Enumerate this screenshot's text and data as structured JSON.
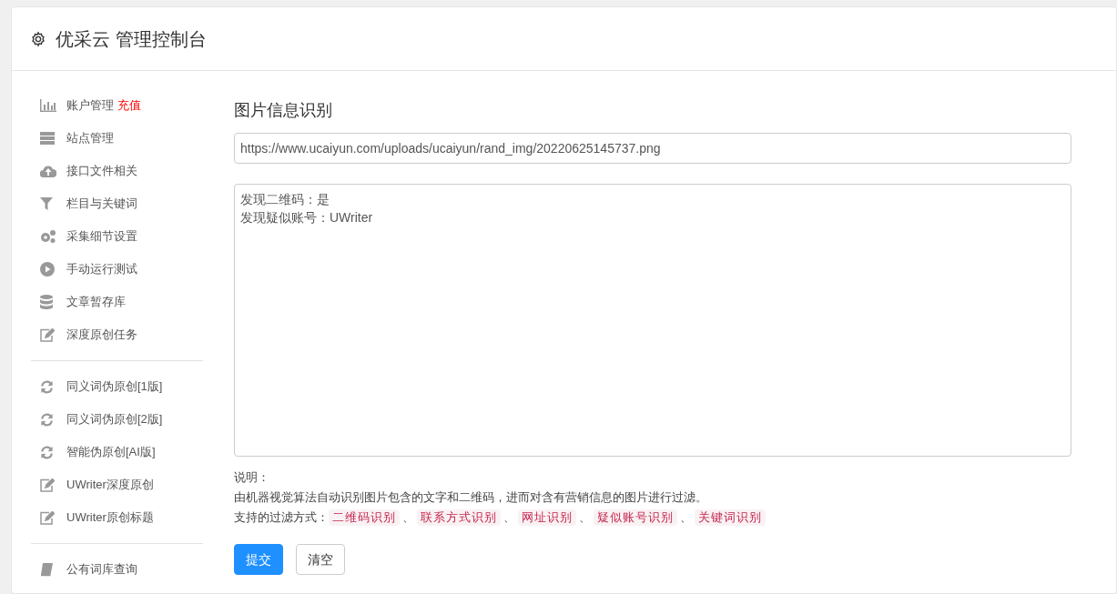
{
  "header": {
    "title": "优采云 管理控制台"
  },
  "sidebar": {
    "groups": [
      {
        "items": [
          {
            "label": "账户管理",
            "badge": "充值"
          },
          {
            "label": "站点管理"
          },
          {
            "label": "接口文件相关"
          },
          {
            "label": "栏目与关键词"
          },
          {
            "label": "采集细节设置"
          },
          {
            "label": "手动运行测试"
          },
          {
            "label": "文章暂存库"
          },
          {
            "label": "深度原创任务"
          }
        ]
      },
      {
        "items": [
          {
            "label": "同义词伪原创[1版]"
          },
          {
            "label": "同义词伪原创[2版]"
          },
          {
            "label": "智能伪原创[AI版]"
          },
          {
            "label": "UWriter深度原创"
          },
          {
            "label": "UWriter原创标题"
          }
        ]
      },
      {
        "items": [
          {
            "label": "公有词库查询"
          }
        ]
      }
    ]
  },
  "main": {
    "title": "图片信息识别",
    "url_field": {
      "value": "https://www.ucaiyun.com/uploads/ucaiyun/rand_img/20220625145737.png"
    },
    "result_box": {
      "lines": [
        "发现二维码：是",
        "发现疑似账号：UWriter"
      ]
    },
    "notes": {
      "heading": "说明：",
      "description": "由机器视觉算法自动识别图片包含的文字和二维码，进而对含有营销信息的图片进行过滤。",
      "methods_label": "支持的过滤方式：",
      "methods": [
        {
          "text": "二维码识别",
          "separator": "、"
        },
        {
          "text": "联系方式识别",
          "separator": "、"
        },
        {
          "text": "网址识别",
          "separator": "、"
        },
        {
          "text": "疑似账号识别",
          "separator": "、"
        },
        {
          "text": "关键词识别"
        }
      ]
    },
    "buttons": [
      {
        "label": "提交",
        "kind": "primary"
      },
      {
        "label": "清空",
        "kind": "default"
      }
    ]
  }
}
